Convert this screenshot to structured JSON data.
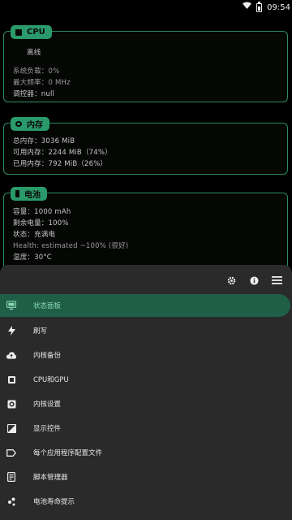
{
  "status_bar": {
    "time": "09:54",
    "icons": [
      "wifi-icon",
      "battery-icon"
    ],
    "battery_fraction": 0.5
  },
  "cpu_card": {
    "title": "CPU",
    "state": "离线",
    "lines": [
      "系统负载：0%",
      "最大频率：0 MHz",
      "调控器：null"
    ]
  },
  "memory_card": {
    "title": "内存",
    "lines": [
      "总内存：3036 MiB",
      "可用内存：2244 MiB（74%）",
      "已用内存：792 MiB（26%）"
    ]
  },
  "battery_card": {
    "title": "电池",
    "lines": [
      "容量：1000 mAh",
      "剩余电量：100%",
      "状态：充满电",
      "Health: estimated ~100% (很好)",
      "温度：30°C"
    ]
  },
  "sheet": {
    "actions": [
      "gear-icon",
      "info-icon",
      "menu-icon"
    ],
    "menu": [
      {
        "label": "状态面板",
        "icon": "monitor-icon",
        "active": true
      },
      {
        "label": "刷写",
        "icon": "flash-icon",
        "active": false
      },
      {
        "label": "内核备份",
        "icon": "cloud-upload-icon",
        "active": false
      },
      {
        "label": "CPU和GPU",
        "icon": "cpu-icon",
        "active": false
      },
      {
        "label": "内核设置",
        "icon": "settings-icon",
        "active": false
      },
      {
        "label": "显示控件",
        "icon": "brightness-icon",
        "active": false
      },
      {
        "label": "每个应用程序配置文件",
        "icon": "label-icon",
        "active": false
      },
      {
        "label": "脚本管理器",
        "icon": "script-icon",
        "active": false
      },
      {
        "label": "电池寿命提示",
        "icon": "scatter-icon",
        "active": false
      }
    ]
  },
  "colors": {
    "accent": "#2a9a6a",
    "active_bg": "#1f5f48",
    "sheet_bg": "#2a2a2a"
  }
}
